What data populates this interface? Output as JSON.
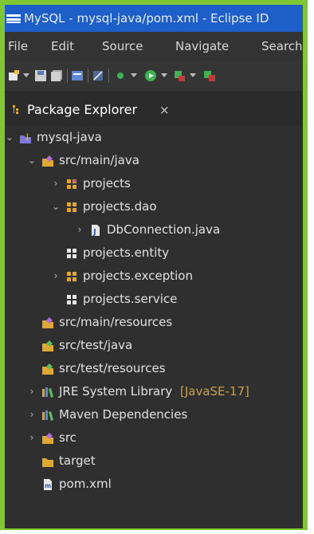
{
  "window": {
    "title": "MySQL - mysql-java/pom.xml - Eclipse ID"
  },
  "menu": [
    "File",
    "Edit",
    "Source",
    "Navigate",
    "Search"
  ],
  "panel": {
    "tab_label": "Package Explorer",
    "close_glyph": "×"
  },
  "tree": {
    "items": [
      {
        "label": "mysql-java",
        "icon": "java-project-icon",
        "expanded": true,
        "depth": 0
      },
      {
        "label": "src/main/java",
        "icon": "source-folder-icon",
        "expanded": true,
        "depth": 1
      },
      {
        "label": "projects",
        "icon": "package-icon",
        "expanded": false,
        "depth": 2
      },
      {
        "label": "projects.dao",
        "icon": "package-icon",
        "expanded": true,
        "depth": 2
      },
      {
        "label": "DbConnection.java",
        "icon": "java-file-icon",
        "expanded": false,
        "depth": 3
      },
      {
        "label": "projects.entity",
        "icon": "empty-package-icon",
        "depth": 2
      },
      {
        "label": "projects.exception",
        "icon": "package-icon",
        "expanded": false,
        "depth": 2
      },
      {
        "label": "projects.service",
        "icon": "empty-package-icon",
        "depth": 2
      },
      {
        "label": "src/main/resources",
        "icon": "source-folder-icon",
        "depth": 1
      },
      {
        "label": "src/test/java",
        "icon": "source-folder-icon",
        "depth": 1
      },
      {
        "label": "src/test/resources",
        "icon": "source-folder-icon",
        "depth": 1
      },
      {
        "label": "JRE System Library",
        "decoration": "[JavaSE-17]",
        "icon": "library-icon",
        "expanded": false,
        "depth": 1
      },
      {
        "label": "Maven Dependencies",
        "icon": "library-icon",
        "expanded": false,
        "depth": 1
      },
      {
        "label": "src",
        "icon": "folder-icon",
        "expanded": false,
        "depth": 1
      },
      {
        "label": "target",
        "icon": "folder-icon",
        "depth": 1
      },
      {
        "label": "pom.xml",
        "icon": "xml-file-icon",
        "depth": 1
      }
    ]
  },
  "colors": {
    "frame_border": "#7fc832",
    "title_bar": "#1d5ec9",
    "background": "#2f2f2f",
    "text": "#e2e2e2",
    "decoration": "#c9a04a",
    "package": "#e0a82e"
  }
}
